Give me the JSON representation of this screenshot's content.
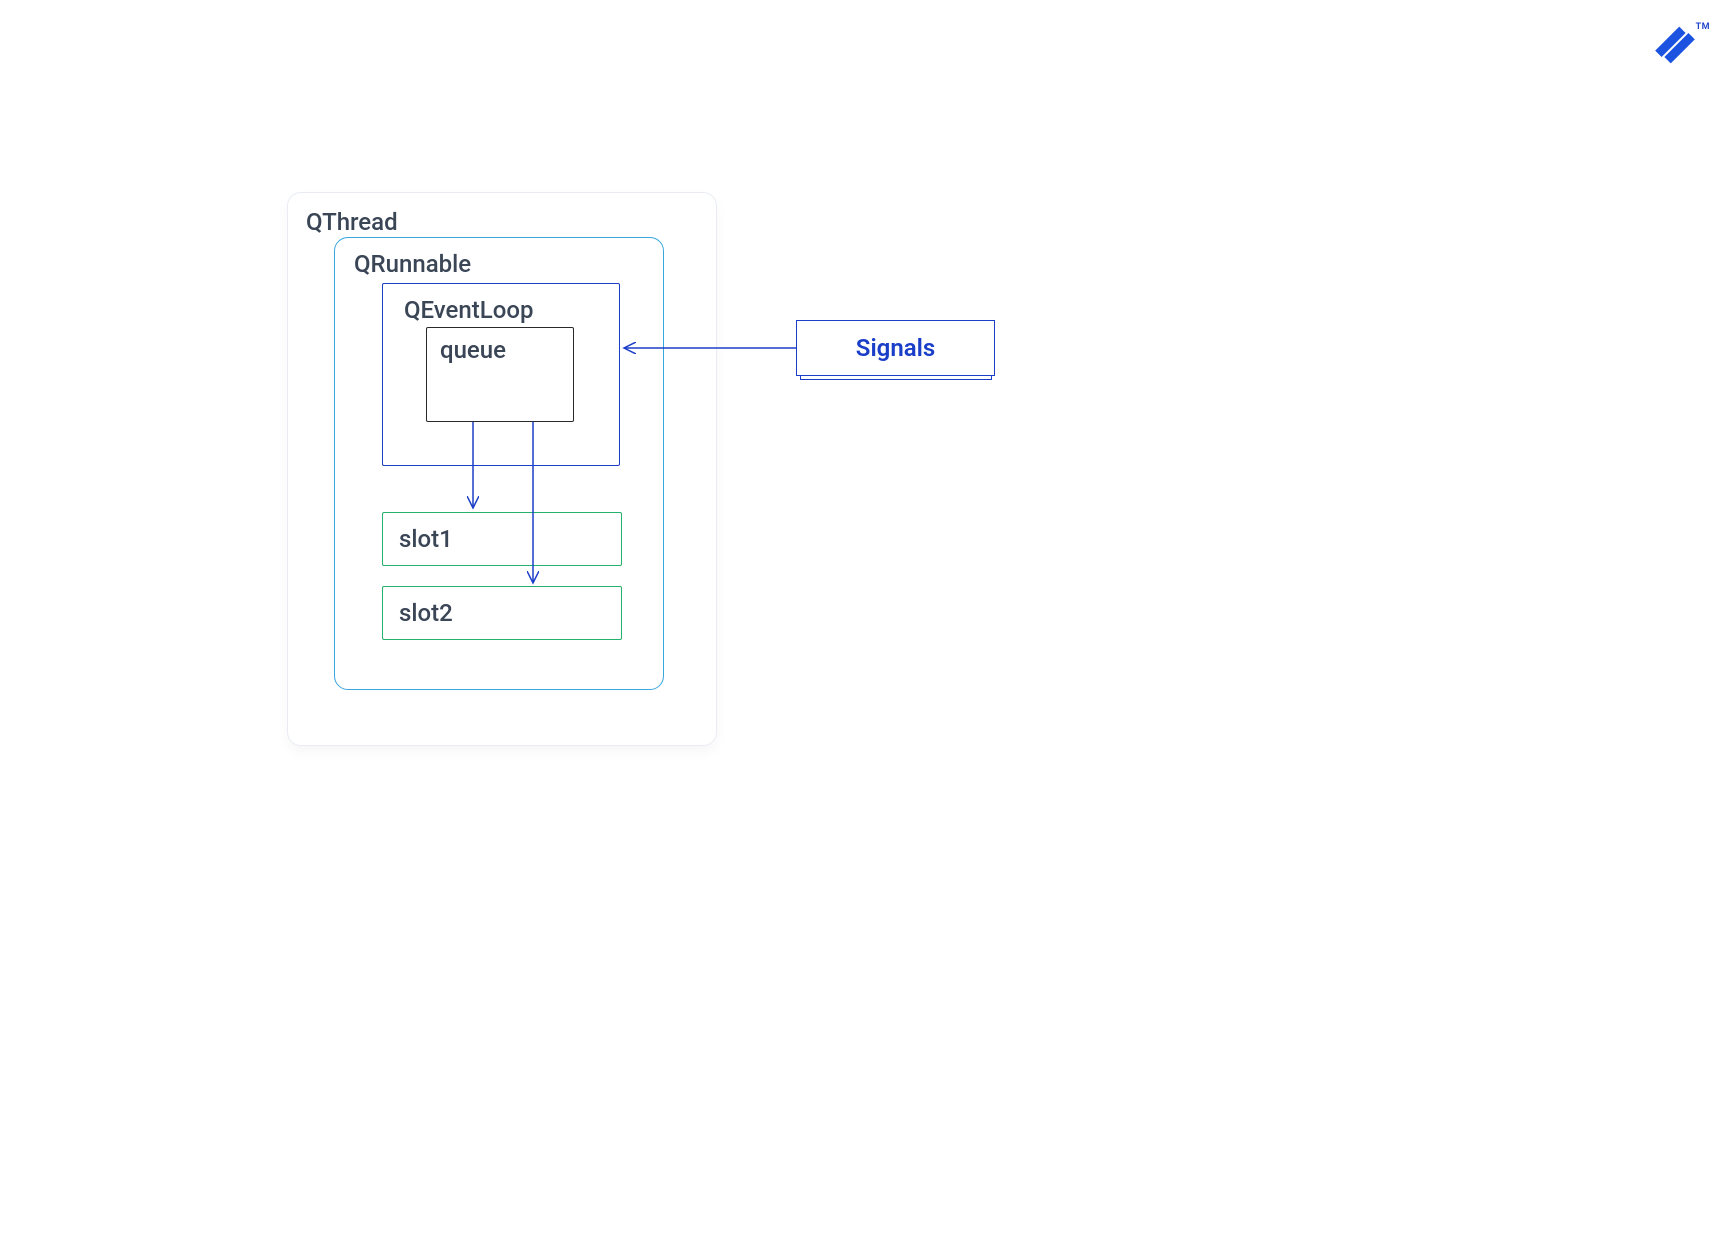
{
  "qthread": {
    "label": "QThread"
  },
  "qrunnable": {
    "label": "QRunnable"
  },
  "qeventloop": {
    "label": "QEventLoop"
  },
  "queue": {
    "label": "queue"
  },
  "slots": {
    "slot1": "slot1",
    "slot2": "slot2"
  },
  "signals": {
    "label": "Signals"
  },
  "trademark": "TM",
  "colors": {
    "outer_border": "#e9edf3",
    "runnable_border": "#3aa6e0",
    "eventloop_border": "#1b3ec9",
    "queue_border": "#2a2a2a",
    "slot_border": "#25b06b",
    "signal_text": "#1b3ec9",
    "arrow": "#1b3ec9",
    "text": "#3a4556"
  }
}
